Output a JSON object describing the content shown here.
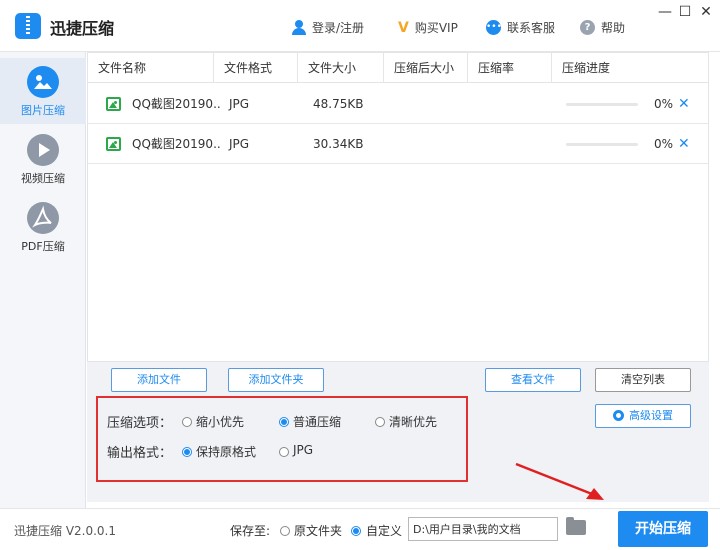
{
  "app": {
    "title": "迅捷压缩",
    "login": "登录/注册",
    "buy_vip": "购买VIP",
    "support": "联系客服",
    "help": "帮助",
    "minimize": "—",
    "maximize": "☐",
    "close": "✕"
  },
  "sidebar": {
    "items": [
      {
        "label": "图片压缩",
        "active": true
      },
      {
        "label": "视频压缩",
        "active": false
      },
      {
        "label": "PDF压缩",
        "active": false
      }
    ]
  },
  "table": {
    "columns": [
      "文件名称",
      "文件格式",
      "文件大小",
      "压缩后大小",
      "压缩率",
      "压缩进度"
    ],
    "rows": [
      {
        "name": "QQ截图20190..",
        "format": "JPG",
        "size": "48.75KB",
        "compressed": "",
        "rate": "",
        "progress": 0,
        "progress_text": "0%"
      },
      {
        "name": "QQ截图20190..",
        "format": "JPG",
        "size": "30.34KB",
        "compressed": "",
        "rate": "",
        "progress": 0,
        "progress_text": "0%"
      }
    ],
    "remove_glyph": "✕"
  },
  "actions": {
    "add_file": "添加文件",
    "add_folder": "添加文件夹",
    "view_file": "查看文件",
    "clear_list": "清空列表",
    "advanced": "高级设置"
  },
  "options": {
    "compress_label": "压缩选项：",
    "compress_choices": [
      "缩小优先",
      "普通压缩",
      "清晰优先"
    ],
    "compress_selected": 1,
    "format_label": "输出格式：",
    "format_choices": [
      "保持原格式",
      "JPG"
    ],
    "format_selected": 0
  },
  "footer": {
    "version": "迅捷压缩 V2.0.0.1",
    "save_to": "保存至:",
    "original_folder": "原文件夹",
    "custom": "自定义",
    "path": "D:\\用户目录\\我的文档",
    "start": "开始压缩"
  },
  "colors": {
    "accent": "#1e8bf0",
    "highlight_box": "#e03030"
  }
}
